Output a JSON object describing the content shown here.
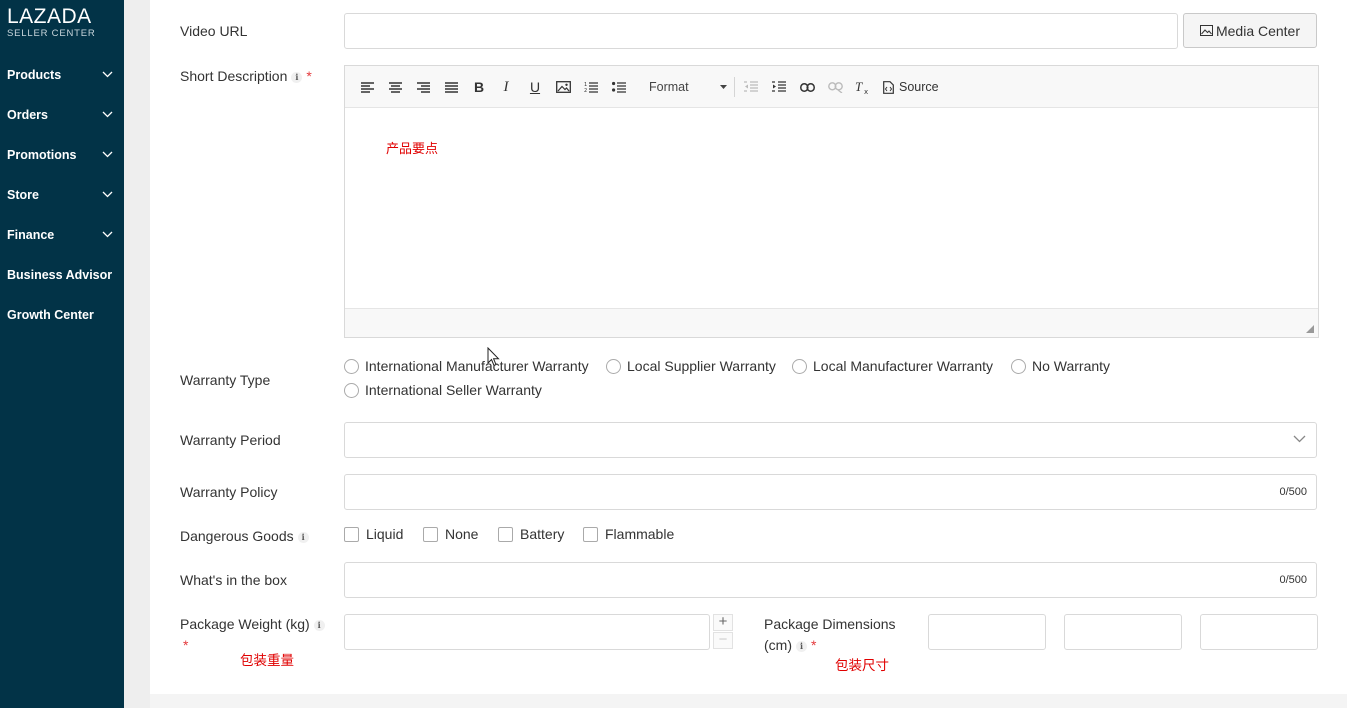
{
  "sidebar": {
    "logo": {
      "main": "LAZADA",
      "sub": "SELLER CENTER"
    },
    "items": [
      {
        "label": "Products",
        "has_chevron": true
      },
      {
        "label": "Orders",
        "has_chevron": true
      },
      {
        "label": "Promotions",
        "has_chevron": true
      },
      {
        "label": "Store",
        "has_chevron": true
      },
      {
        "label": "Finance",
        "has_chevron": true
      },
      {
        "label": "Business Advisor",
        "has_chevron": false
      },
      {
        "label": "Growth Center",
        "has_chevron": false
      }
    ],
    "bg_color": "#023347"
  },
  "form": {
    "video_url": {
      "label": "Video URL",
      "value": "",
      "button": "Media Center"
    },
    "short_description": {
      "label": "Short Description",
      "required_mark": "*",
      "toolbar": {
        "format_label": "Format",
        "source_label": "Source",
        "buttons": [
          "align-left-icon",
          "align-center-icon",
          "align-right-icon",
          "align-justify-icon",
          "bold-icon",
          "italic-icon",
          "underline-icon",
          "image-icon",
          "numbered-list-icon",
          "bulleted-list-icon",
          "outdent-icon",
          "indent-icon",
          "link-icon",
          "unlink-icon",
          "clear-format-icon",
          "source-icon"
        ]
      },
      "content": "产品要点"
    },
    "warranty_type": {
      "label": "Warranty Type",
      "options": [
        "International Manufacturer Warranty",
        "Local Supplier Warranty",
        "Local Manufacturer Warranty",
        "No Warranty",
        "International Seller Warranty"
      ]
    },
    "warranty_period": {
      "label": "Warranty Period",
      "value": ""
    },
    "warranty_policy": {
      "label": "Warranty Policy",
      "value": "",
      "counter": "0/500"
    },
    "dangerous_goods": {
      "label": "Dangerous Goods",
      "options": [
        "Liquid",
        "None",
        "Battery",
        "Flammable"
      ]
    },
    "whats_in_box": {
      "label": "What's in the box",
      "value": "",
      "counter": "0/500"
    },
    "package_weight": {
      "label": "Package Weight (kg)",
      "required_mark": "*",
      "value": "",
      "note": "包装重量"
    },
    "package_dimensions": {
      "label_line1": "Package Dimensions",
      "label_line2": "(cm)",
      "required_mark": "*",
      "note": "包装尺寸"
    }
  },
  "colors": {
    "required": "#e4393c",
    "annotation": "#e00000",
    "sidebar": "#023347"
  }
}
